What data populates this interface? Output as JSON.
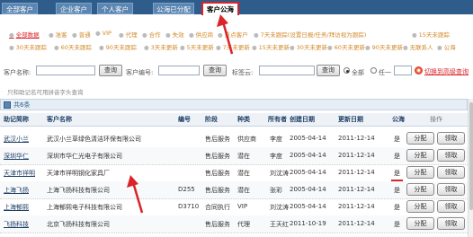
{
  "tabs": [
    {
      "label": "全部客户",
      "active": false
    },
    {
      "label": "企业客户",
      "active": false
    },
    {
      "label": "个人客户",
      "active": false
    },
    {
      "label": "公海已分配",
      "active": false
    },
    {
      "label": "客户公海",
      "active": true
    }
  ],
  "filters": {
    "row1": [
      {
        "label": "全部数据",
        "active": true
      },
      {
        "label": "准客",
        "active": false
      },
      {
        "label": "普通",
        "active": false
      },
      {
        "label": "VIP",
        "active": false
      },
      {
        "label": "代理",
        "active": false
      },
      {
        "label": "合作",
        "active": false
      },
      {
        "label": "失效",
        "active": false
      },
      {
        "label": "供应商",
        "active": false
      },
      {
        "label": "重点客户",
        "active": false
      },
      {
        "label": "7天未跟踪(设置日报/任务/拜访视为跟踪)",
        "active": false
      },
      {
        "label": "15天未跟踪",
        "active": false
      }
    ],
    "row2": [
      {
        "label": "30天未跟踪",
        "active": false
      },
      {
        "label": "60天未跟踪",
        "active": false
      },
      {
        "label": "90天未跟踪",
        "active": false
      },
      {
        "label": "3天未更新",
        "active": false
      },
      {
        "label": "5天未更新",
        "active": false
      },
      {
        "label": "7天未更新",
        "active": false
      },
      {
        "label": "15天未更新",
        "active": false
      },
      {
        "label": "30天未更新",
        "active": false
      },
      {
        "label": "60天未更新",
        "active": false
      },
      {
        "label": "90天未更新",
        "active": false
      },
      {
        "label": "无联系人",
        "active": false
      },
      {
        "label": "公海",
        "active": false
      }
    ]
  },
  "search": {
    "customer_name_label": "客户名称:",
    "customer_no_label": "客户编号:",
    "tag_cloud_label": "标签云:",
    "query_label": "查询",
    "radio_all": "全部",
    "radio_any": "任一",
    "toggle_label": "切换到高级查询",
    "help_text": "只和助记名可用拼音字头查询"
  },
  "grid": {
    "count_text": "共6条",
    "headers": [
      "助记简称",
      "客户名称",
      "编号",
      "阶段",
      "种类",
      "所有者",
      "创建日期",
      "更新日期",
      "公海",
      "操作"
    ],
    "assign_label": "分配",
    "claim_label": "领取",
    "rows": [
      {
        "short": "武汉小兰",
        "name": "武汉小兰草绿色清洁环保有限公司",
        "no": "",
        "stage": "售后服务",
        "kind": "供应商",
        "owner": "李度",
        "created": "2005-04-14",
        "updated": "2011-12-14",
        "pool": "是"
      },
      {
        "short": "深圳华仁",
        "name": "深圳市华仁光电子有限公司",
        "no": "",
        "stage": "售后服务",
        "kind": "潜在",
        "owner": "李度",
        "created": "2005-04-14",
        "updated": "2011-12-14",
        "pool": "是"
      },
      {
        "short": "天津市祥明",
        "name": "天津市祥明钢化家具厂",
        "no": "",
        "stage": "售后服务",
        "kind": "潜在",
        "owner": "刘沈涛",
        "created": "2005-04-14",
        "updated": "2011-12-14",
        "pool": "是"
      },
      {
        "short": "上海飞扬",
        "name": "上海飞扬科技有限公司",
        "no": "D255",
        "stage": "售后服务",
        "kind": "潜在",
        "owner": "张彩",
        "created": "2005-04-14",
        "updated": "2011-12-14",
        "pool": "是"
      },
      {
        "short": "上海郁熙",
        "name": "上海郁熙电子科技有限公司",
        "no": "D3710",
        "stage": "合同执行",
        "kind": "VIP",
        "owner": "刘沈涛",
        "created": "2005-04-14",
        "updated": "2011-12-14",
        "pool": "是"
      },
      {
        "short": "飞扬科技",
        "name": "北京飞扬科技有限公司",
        "no": "",
        "stage": "售后服务",
        "kind": "代理",
        "owner": "王天红",
        "created": "2011-10-19",
        "updated": "2011-12-14",
        "pool": "是"
      }
    ]
  },
  "colors": {
    "accent_red": "#d9242a",
    "tab_bar": "#2e5d8c",
    "filter_link": "#d28a2a"
  }
}
